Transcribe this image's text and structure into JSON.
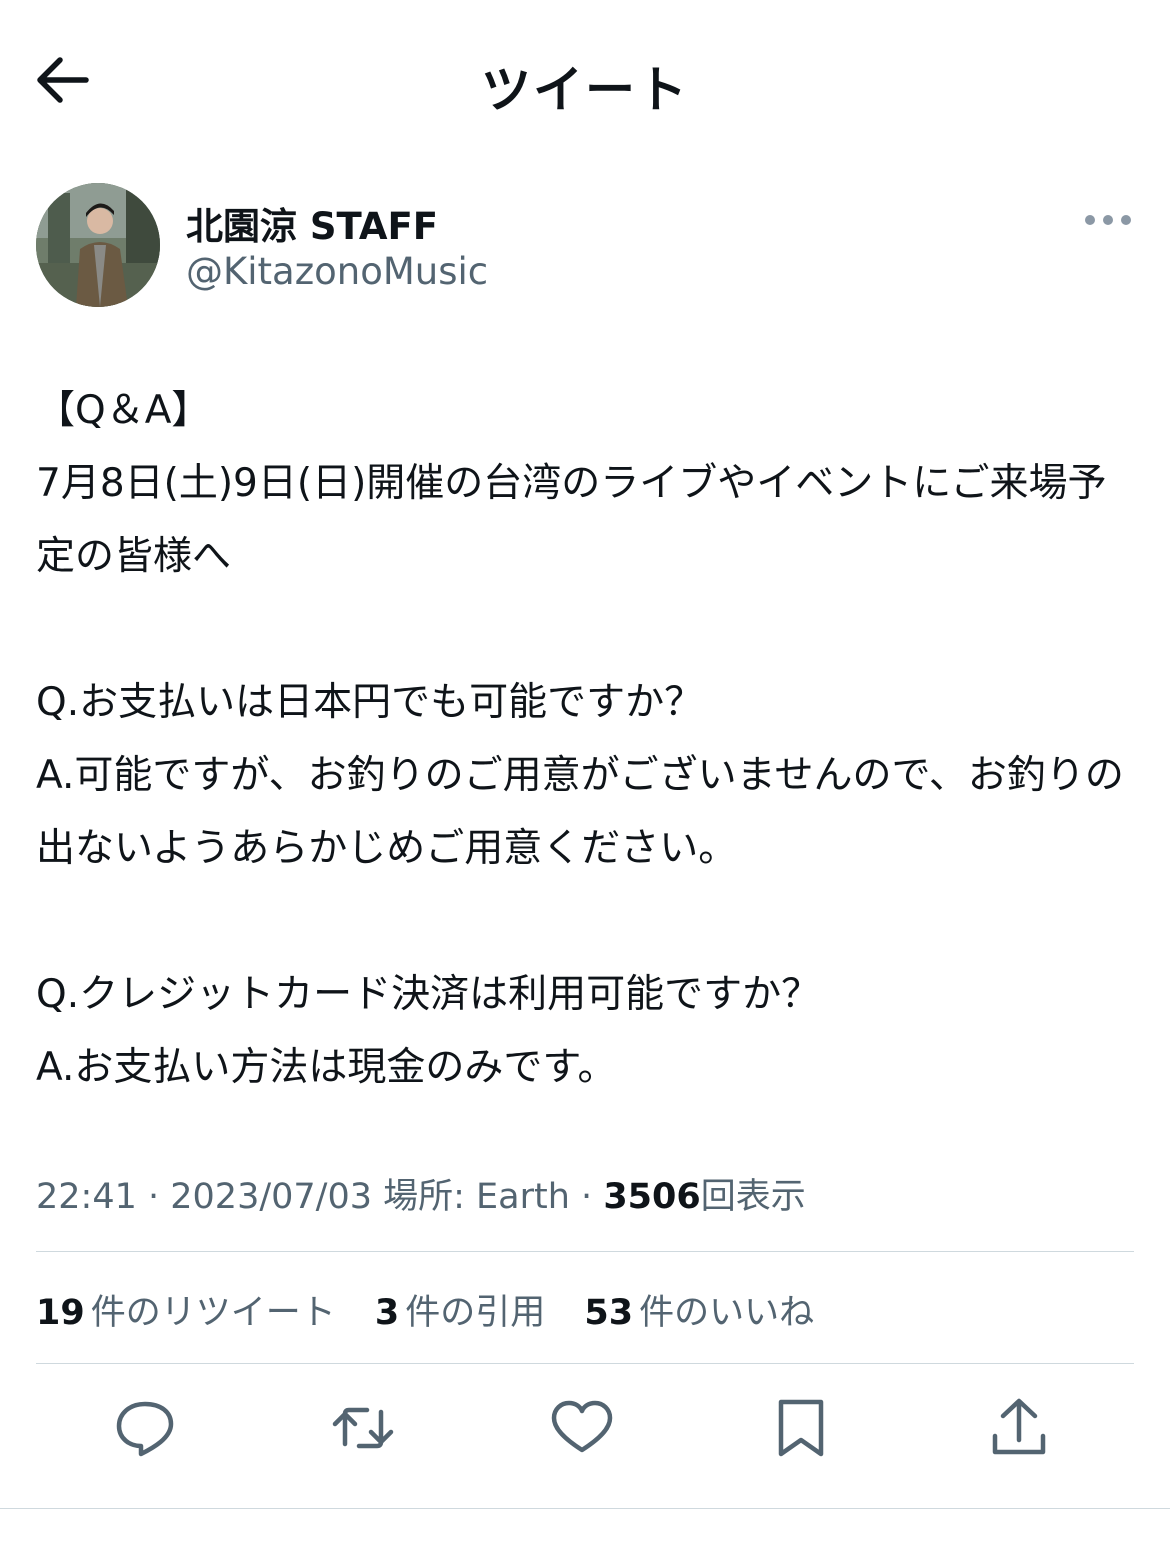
{
  "header": {
    "title": "ツイート",
    "back_icon": "arrow-left-icon"
  },
  "author": {
    "display_name": "北園涼 STAFF",
    "handle": "@KitazonoMusic"
  },
  "tweet": {
    "text": "【Q＆A】\n7月8日(土)9日(日)開催の台湾のライブやイベントにご来場予定の皆様へ\n\nQ.お支払いは日本円でも可能ですか？\nA.可能ですが、お釣りのご用意がございませんので、お釣りの出ないようあらかじめご用意ください。\n\nQ.クレジットカード決済は利用可能ですか？\nA.お支払い方法は現金のみです。"
  },
  "meta": {
    "time": "22:41",
    "separator": " · ",
    "date": "2023/07/03",
    "location": "場所: Earth",
    "views_count": "3506",
    "views_label": "回表示"
  },
  "stats": {
    "retweets_count": "19",
    "retweets_label": "件のリツイート",
    "quotes_count": "3",
    "quotes_label": "件の引用",
    "likes_count": "53",
    "likes_label": "件のいいね"
  },
  "actions": [
    "reply-icon",
    "retweet-icon",
    "like-icon",
    "bookmark-icon",
    "share-icon"
  ],
  "colors": {
    "text": "#0f1419",
    "secondary": "#536471",
    "divider": "#cfd9de"
  }
}
